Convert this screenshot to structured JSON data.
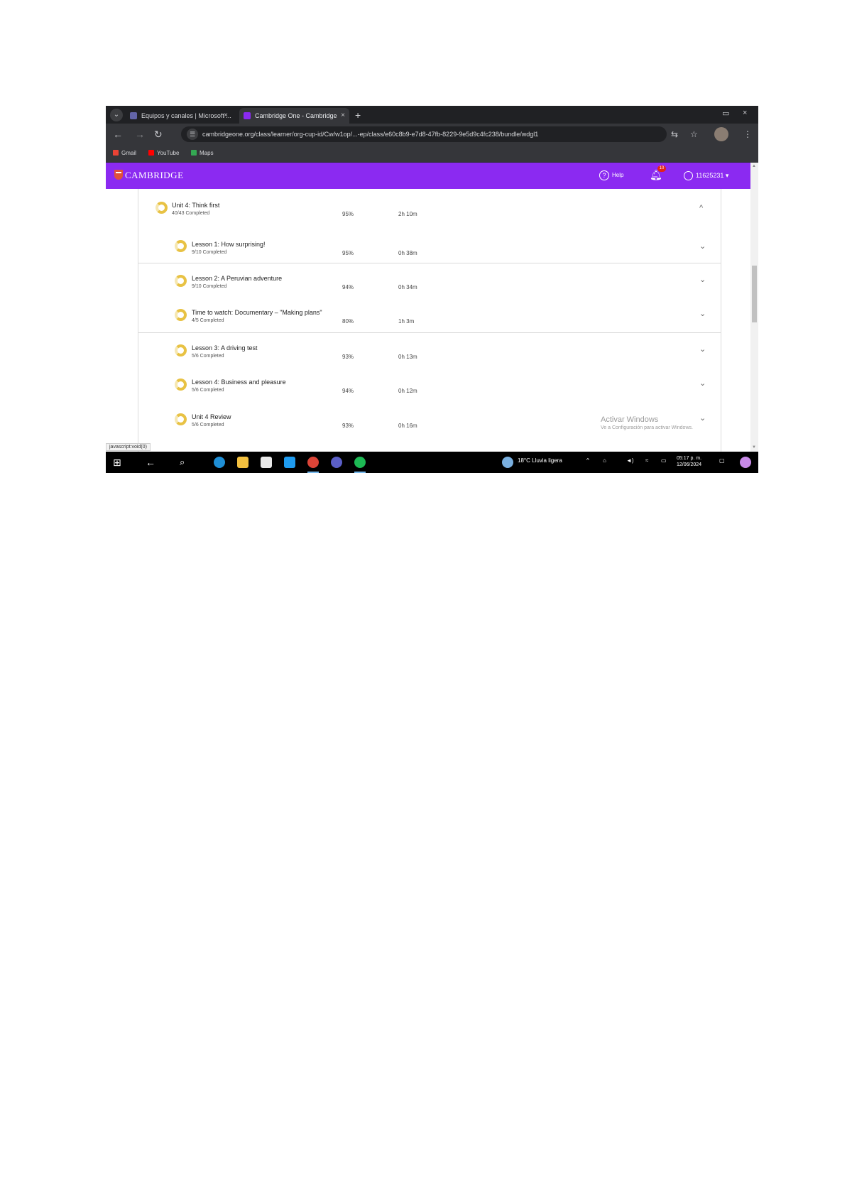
{
  "browser": {
    "tabs": [
      {
        "title": "Equipos y canales | Microsoft ...",
        "close": "×"
      },
      {
        "title": "Cambridge One - Cambridge",
        "close": "×"
      }
    ],
    "new_tab": "+",
    "window_controls": {
      "maximize": "▭",
      "close": "×"
    },
    "url": "cambridgeone.org/class/learner/org-cup-id/Cw/w1op/...-ep/class/e60c8b9-e7d8-47fb-8229-9e5d9c4fc238/bundle/wdgl1",
    "bookmarks": [
      {
        "label": "Gmail",
        "color": "#ea4335"
      },
      {
        "label": "YouTube",
        "color": "#ff0000"
      },
      {
        "label": "Maps",
        "color": "#34a853"
      }
    ]
  },
  "app": {
    "logo_text": "CAMBRIDGE",
    "help_label": "Help",
    "notification_count": "10",
    "user_id": "11625231",
    "accent_color": "#8b2af1",
    "progress_color": "#e8c244"
  },
  "units": [
    {
      "title": "Unit 4: Think first",
      "sub": "40/43 Completed",
      "pct": "95%",
      "time": "2h 10m",
      "expanded": true,
      "chevron": "^"
    },
    {
      "title": "Lesson 1: How surprising!",
      "sub": "9/10 Completed",
      "pct": "95%",
      "time": "0h 38m",
      "chevron": "⌄"
    },
    {
      "title": "Lesson 2: A Peruvian adventure",
      "sub": "9/10 Completed",
      "pct": "94%",
      "time": "0h 34m",
      "chevron": "⌄"
    },
    {
      "title": "Time to watch: Documentary – \"Making plans\"",
      "sub": "4/5 Completed",
      "pct": "80%",
      "time": "1h 3m",
      "chevron": "⌄"
    },
    {
      "title": "Lesson 3: A driving test",
      "sub": "5/6 Completed",
      "pct": "93%",
      "time": "0h 13m",
      "chevron": "⌄"
    },
    {
      "title": "Lesson 4: Business and pleasure",
      "sub": "5/6 Completed",
      "pct": "94%",
      "time": "0h 12m",
      "chevron": "⌄"
    },
    {
      "title": "Unit 4 Review",
      "sub": "5/6 Completed",
      "pct": "93%",
      "time": "0h 16m",
      "chevron": "⌄"
    }
  ],
  "watermark": {
    "line1": "Activar Windows",
    "line2": "Ve a Configuración para activar Windows."
  },
  "status_tip": "javascript:void(0)",
  "taskbar": {
    "weather": "18°C  Lluvia ligera",
    "time": "05:17 p. m.",
    "date": "12/06/2024"
  }
}
